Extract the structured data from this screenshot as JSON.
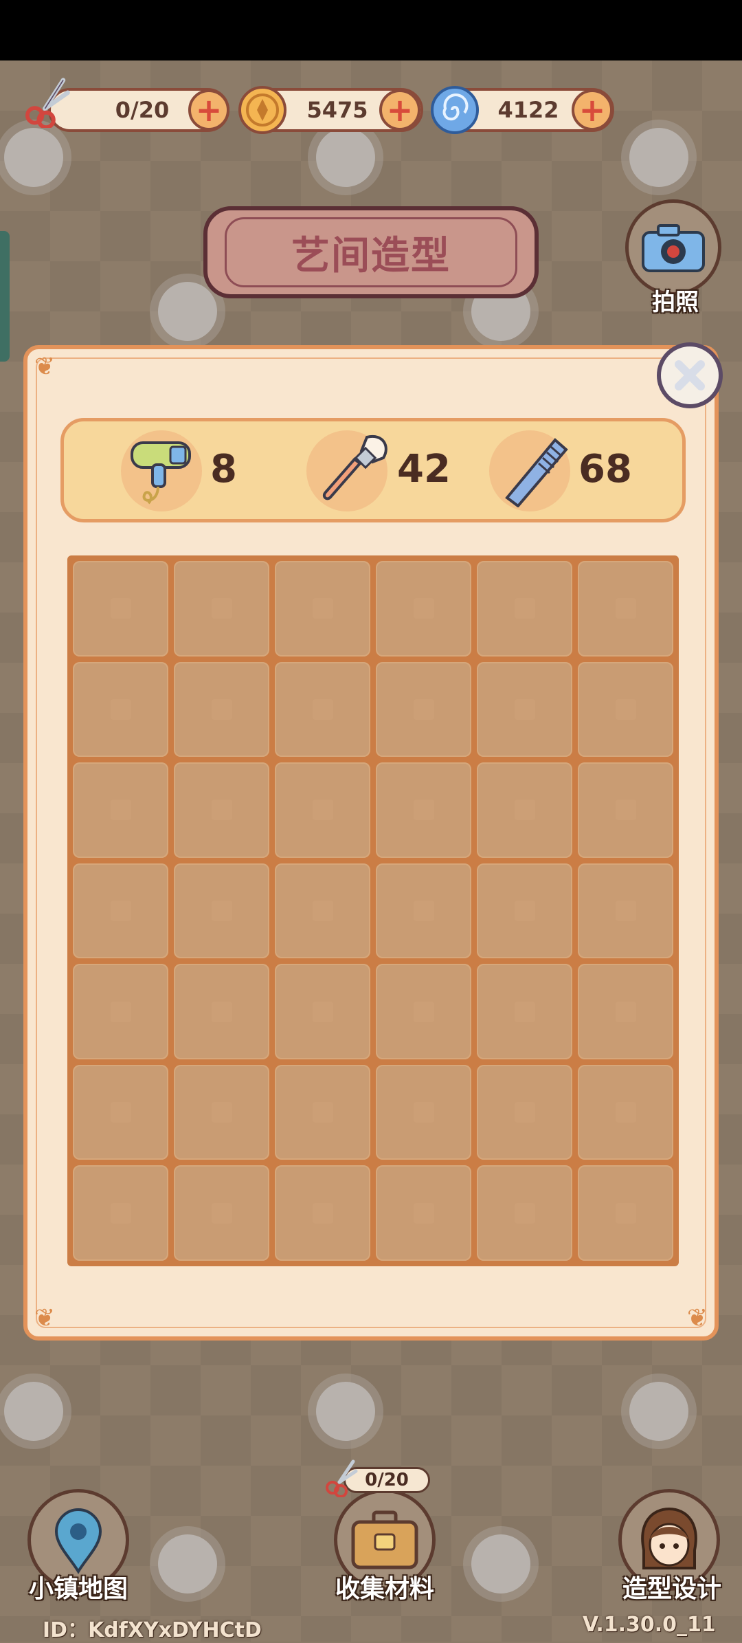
{
  "resources": {
    "scissors": {
      "value": "0/20",
      "icon": "scissors-icon"
    },
    "coins": {
      "value": "5475",
      "icon": "coin-icon"
    },
    "gems": {
      "value": "4122",
      "icon": "swirl-gem-icon"
    },
    "plus_symbol": "+"
  },
  "title": "艺间造型",
  "camera": {
    "label": "拍照"
  },
  "tools": [
    {
      "name": "hair-dryer",
      "count": "8"
    },
    {
      "name": "makeup-brush",
      "count": "42"
    },
    {
      "name": "comb",
      "count": "68"
    }
  ],
  "grid": {
    "columns": 6,
    "rows": 7
  },
  "bottom_nav": {
    "map_label": "小镇地图",
    "collect_label": "收集材料",
    "collect_badge": "0/20",
    "design_label": "造型设计"
  },
  "footer": {
    "user_id": "ID：KdfXYxDYHCtD",
    "version": "V.1.30.0_11"
  },
  "colors": {
    "panel_bg": "#f9e6cf",
    "panel_border": "#e3935a",
    "grid_bg": "#cb7d45",
    "cell": "#c99c73",
    "title_text": "#9b4d57"
  }
}
